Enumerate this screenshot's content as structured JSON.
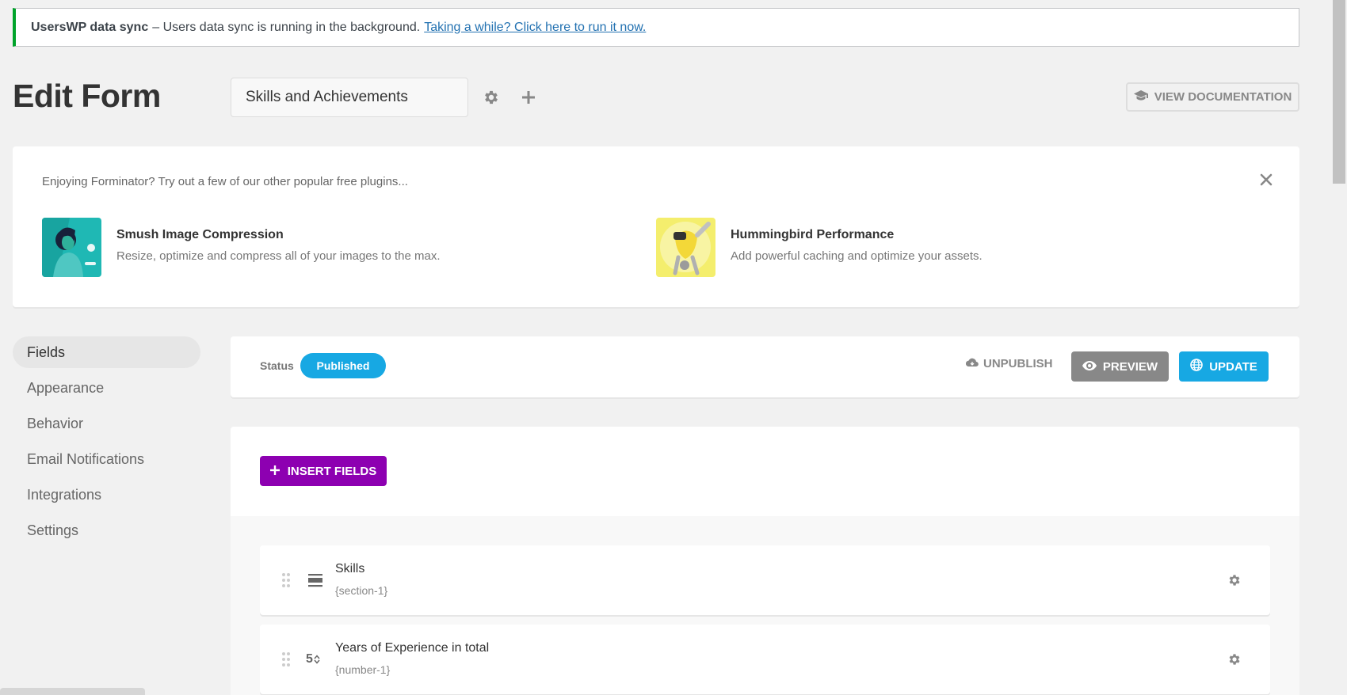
{
  "notice": {
    "title": "UsersWP data sync",
    "text": "– Users data sync is running in the background.",
    "link": "Taking a while? Click here to run it now."
  },
  "header": {
    "title": "Edit Form",
    "form_name": "Skills and Achievements",
    "doc_button": "VIEW DOCUMENTATION"
  },
  "promo": {
    "intro": "Enjoying Forminator? Try out a few of our other popular free plugins...",
    "plugins": [
      {
        "name": "Smush Image Compression",
        "desc": "Resize, optimize and compress all of your images to the max."
      },
      {
        "name": "Hummingbird Performance",
        "desc": "Add powerful caching and optimize your assets."
      }
    ]
  },
  "sidebar": {
    "items": [
      {
        "label": "Fields"
      },
      {
        "label": "Appearance"
      },
      {
        "label": "Behavior"
      },
      {
        "label": "Email Notifications"
      },
      {
        "label": "Integrations"
      },
      {
        "label": "Settings"
      }
    ],
    "active_index": 0
  },
  "status_bar": {
    "label": "Status",
    "status": "Published",
    "unpublish": "UNPUBLISH",
    "preview": "PREVIEW",
    "update": "UPDATE"
  },
  "builder": {
    "insert_button": "INSERT FIELDS",
    "fields": [
      {
        "label": "Skills",
        "id": "{section-1}",
        "type_icon": "section-icon"
      },
      {
        "label": "Years of Experience in total",
        "id": "{number-1}",
        "type_icon": "number-icon",
        "type_glyph": "5"
      }
    ]
  },
  "colors": {
    "accent_blue": "#17a8e3",
    "insert_purple": "#8d00b1",
    "notice_green": "#00a32a",
    "preview_gray": "#888888"
  }
}
